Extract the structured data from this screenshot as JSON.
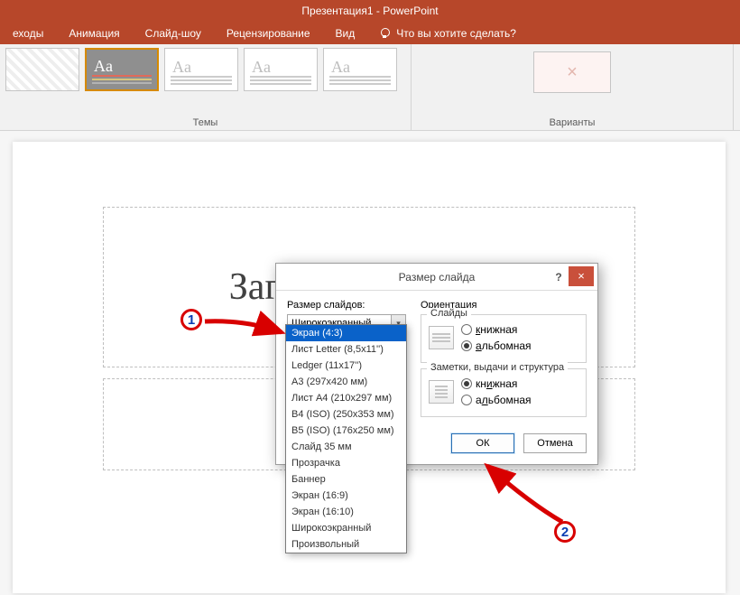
{
  "app": {
    "title": "Презентация1 - PowerPoint"
  },
  "tabs": {
    "transitions": "еходы",
    "animation": "Анимация",
    "slideshow": "Слайд-шоу",
    "review": "Рецензирование",
    "view": "Вид",
    "tellme": "Что вы хотите сделать?"
  },
  "ribbon": {
    "themes_aa": "Aa",
    "themes_label": "Темы",
    "variants_label": "Варианты"
  },
  "slide": {
    "title_placeholder": "Заголовок слайда"
  },
  "dialog": {
    "title": "Размер слайда",
    "help": "?",
    "close": "×",
    "size_label": "Размер слайдов:",
    "size_selected": "Широкоэкранный",
    "orientation_label": "Ориентация",
    "slides_label": "Слайды",
    "notes_label": "Заметки, выдачи и структура",
    "portrait": "книжная",
    "landscape": "альбомная",
    "ok": "ОК",
    "cancel": "Отмена"
  },
  "size_options": [
    "Экран (4:3)",
    "Лист Letter (8,5x11'')",
    "Ledger (11x17'')",
    "A3 (297x420 мм)",
    "Лист A4 (210x297 мм)",
    "B4 (ISO) (250x353 мм)",
    "B5 (ISO) (176x250 мм)",
    "Слайд 35 мм",
    "Прозрачка",
    "Баннер",
    "Экран (16:9)",
    "Экран (16:10)",
    "Широкоэкранный",
    "Произвольный"
  ],
  "annotations": {
    "n1": "1",
    "n2": "2"
  }
}
